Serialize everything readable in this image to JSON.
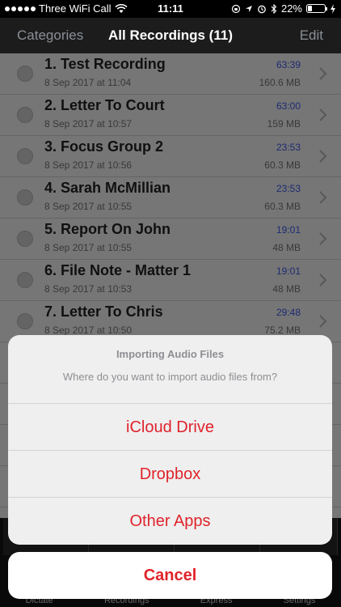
{
  "status_bar": {
    "carrier": "Three WiFi Call",
    "time": "11:11",
    "battery_percent": "22%",
    "battery_level": 0.22,
    "icons": [
      "signal-dots-icon",
      "wifi-icon",
      "orientation-lock-icon",
      "location-icon",
      "alarm-icon",
      "bluetooth-icon",
      "battery-icon",
      "charging-icon"
    ]
  },
  "navbar": {
    "left": "Categories",
    "title": "All Recordings (11)",
    "right": "Edit"
  },
  "recordings": [
    {
      "title": "1. Test Recording",
      "date": "8 Sep 2017 at 11:04",
      "duration": "63:39",
      "size": "160.6 MB"
    },
    {
      "title": "2. Letter To Court",
      "date": "8 Sep 2017 at 10:57",
      "duration": "63:00",
      "size": "159 MB"
    },
    {
      "title": "3. Focus Group 2",
      "date": "8 Sep 2017 at 10:56",
      "duration": "23:53",
      "size": "60.3 MB"
    },
    {
      "title": "4. Sarah McMillian",
      "date": "8 Sep 2017 at 10:55",
      "duration": "23:53",
      "size": "60.3 MB"
    },
    {
      "title": "5. Report On John",
      "date": "8 Sep 2017 at 10:55",
      "duration": "19:01",
      "size": "48 MB"
    },
    {
      "title": "6. File Note - Matter 1",
      "date": "8 Sep 2017 at 10:53",
      "duration": "19:01",
      "size": "48 MB"
    },
    {
      "title": "7. Letter To Chris",
      "date": "8 Sep 2017 at 10:50",
      "duration": "29:48",
      "size": "75.2 MB"
    }
  ],
  "tabbar": {
    "tabs": [
      "Dictate",
      "Recordings",
      "Express",
      "Settings"
    ]
  },
  "action_sheet": {
    "title": "Importing Audio Files",
    "message": "Where do you want to import audio files from?",
    "options": [
      "iCloud Drive",
      "Dropbox",
      "Other Apps"
    ],
    "cancel": "Cancel"
  },
  "colors": {
    "accent_red": "#e0232b",
    "duration_blue": "#1f2d78"
  }
}
